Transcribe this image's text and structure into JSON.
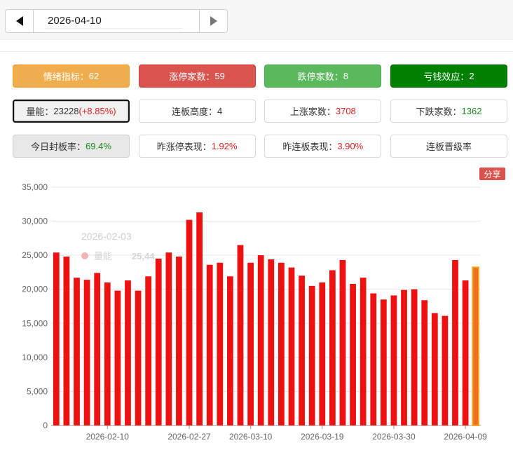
{
  "date_nav": {
    "date": "2026-04-10"
  },
  "stats": {
    "sentiment": {
      "label": "情绪指标：",
      "value": "62"
    },
    "limit_up": {
      "label": "涨停家数：",
      "value": "59"
    },
    "limit_down": {
      "label": "跌停家数：",
      "value": "8"
    },
    "loss_effect": {
      "label": "亏钱效应：",
      "value": "2"
    },
    "volume": {
      "label": "量能：",
      "value": "23228",
      "change": "(+8.85%)"
    },
    "board_height": {
      "label": "连板高度：",
      "value": "4"
    },
    "rise_count": {
      "label": "上涨家数：",
      "value": "3708"
    },
    "fall_count": {
      "label": "下跌家数：",
      "value": "1362"
    },
    "seal_rate": {
      "label": "今日封板率：",
      "value": "69.4%"
    },
    "prev_limit_perf": {
      "label": "昨涨停表现：",
      "value": "1.92%"
    },
    "prev_board_perf": {
      "label": "昨连板表现：",
      "value": "3.90%"
    },
    "promotion_rate": {
      "label": "连板晋级率"
    }
  },
  "share_label": "分享",
  "colors": {
    "bar": "#ee1111",
    "highlight": "#f07020",
    "highlight_border": "#f5a623"
  },
  "chart_data": {
    "type": "bar",
    "series": [
      {
        "name": "量能",
        "values": [
          25400,
          24800,
          21700,
          21400,
          22400,
          21000,
          19800,
          21300,
          19800,
          21900,
          24500,
          25400,
          24800,
          30200,
          31300,
          23600,
          23900,
          21900,
          26500,
          23900,
          25000,
          24400,
          23900,
          23200,
          22000,
          20500,
          21000,
          22800,
          24300,
          20800,
          21700,
          19400,
          18500,
          19100,
          19900,
          20000,
          18400,
          16500,
          16100,
          24300,
          21300,
          23228
        ]
      }
    ],
    "x_ticks": [
      "2026-02-10",
      "2026-02-27",
      "2026-03-10",
      "2026-03-19",
      "2026-03-30",
      "2026-04-09"
    ],
    "y_ticks": [
      "0",
      "5,000",
      "10,000",
      "15,000",
      "20,000",
      "25,000",
      "30,000",
      "35,000"
    ],
    "ylim": [
      0,
      35000
    ],
    "highlight_index": 41,
    "tooltip": {
      "date": "2026-02-03",
      "series_label": "量能",
      "value": "25,44"
    }
  }
}
